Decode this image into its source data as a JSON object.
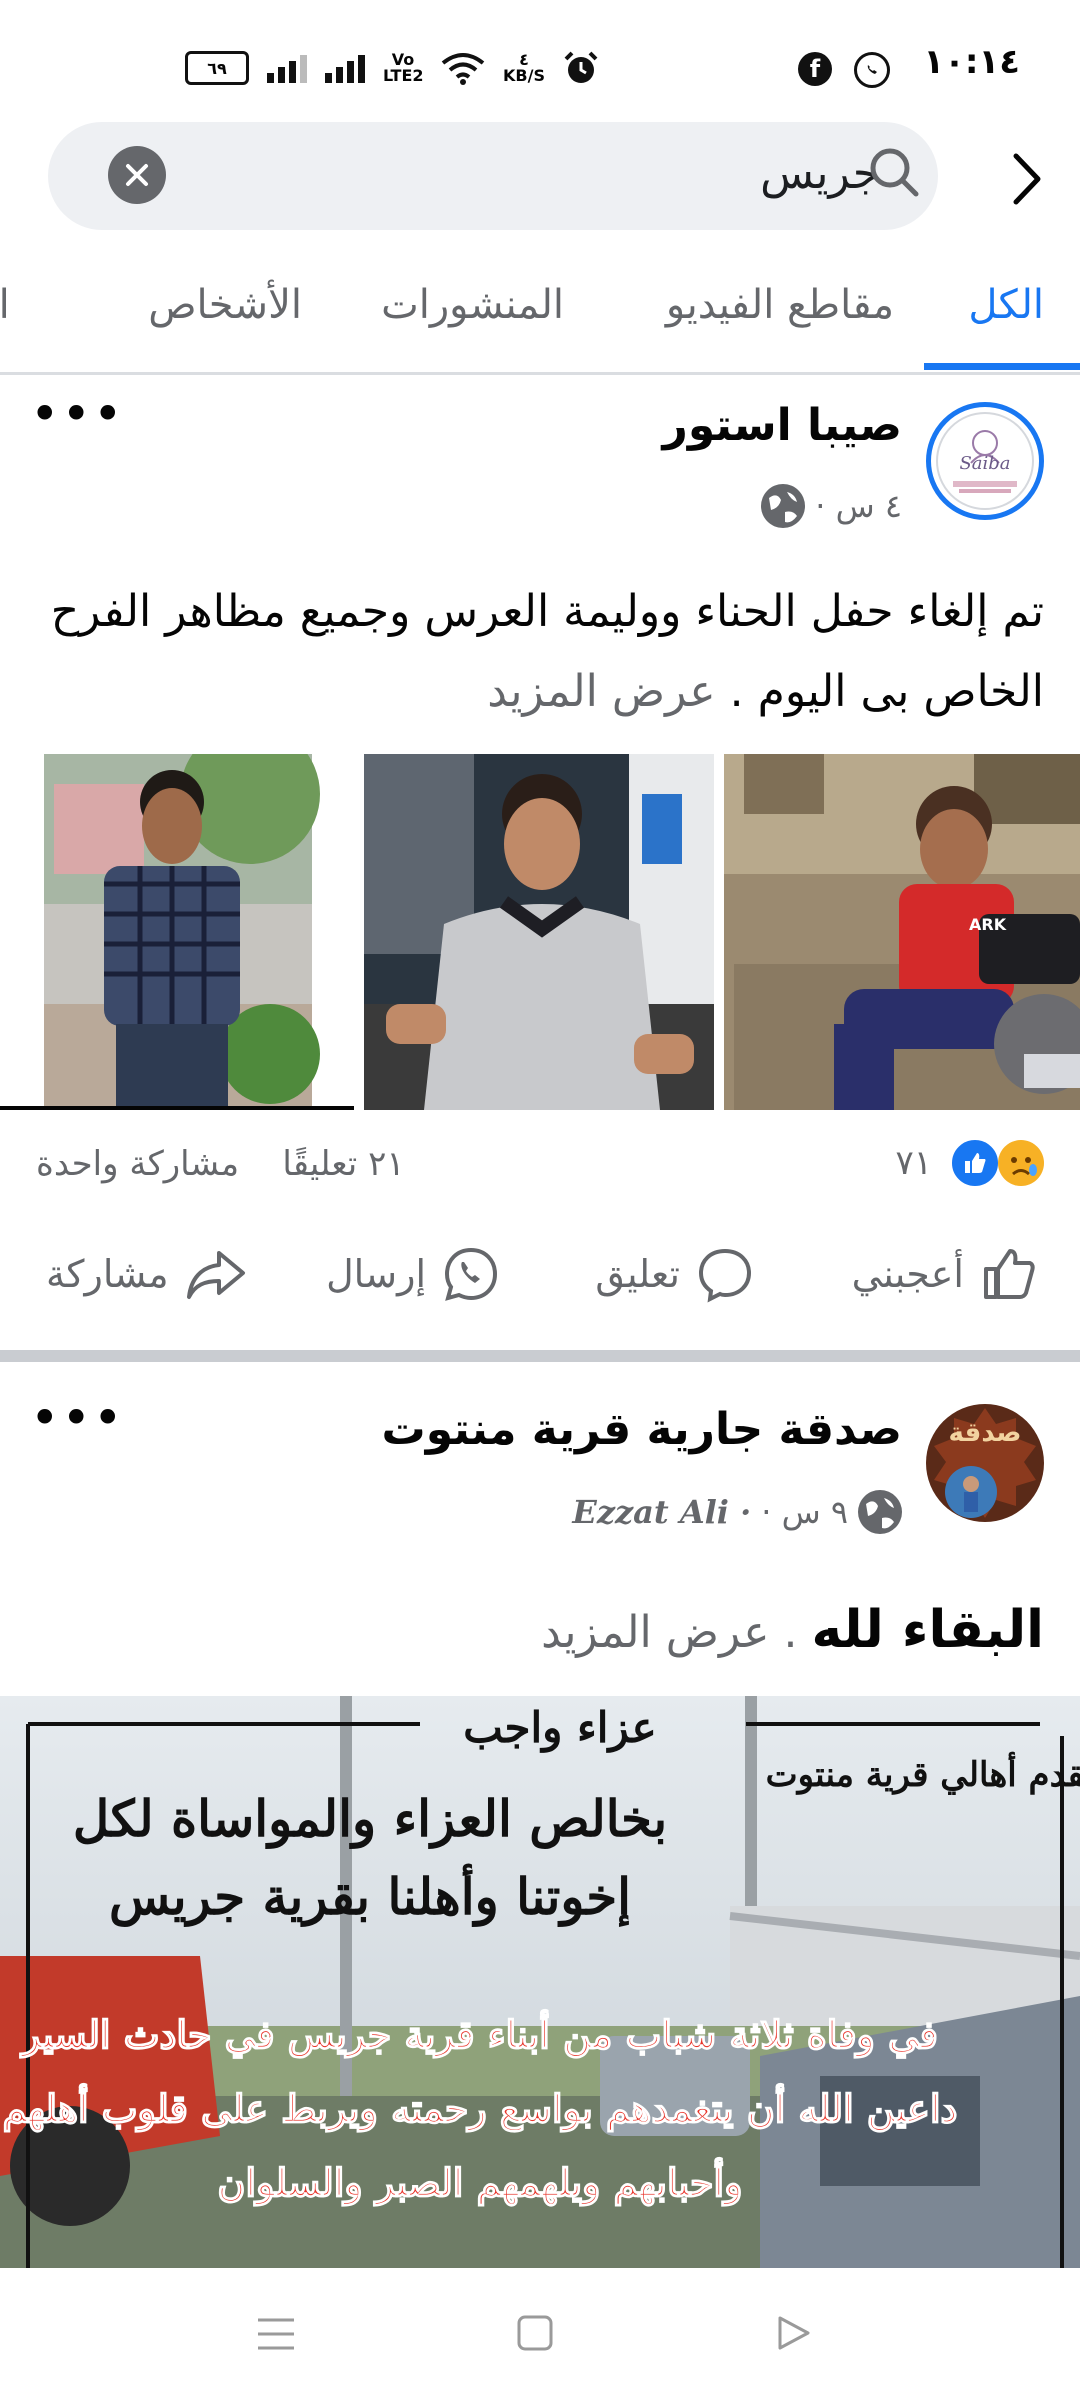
{
  "status_bar": {
    "time": "١٠:١٤",
    "battery": "٦٩",
    "network_speed_value": "٤",
    "network_speed_unit": "KB/S",
    "volte": "Vo LTE2"
  },
  "search": {
    "query": "جريس"
  },
  "tabs": [
    {
      "label": "الكل",
      "active": true
    },
    {
      "label": "مقاطع الفيديو",
      "active": false
    },
    {
      "label": "المنشورات",
      "active": false
    },
    {
      "label": "الأشخاص",
      "active": false
    },
    {
      "label": "المجموعات",
      "active": false
    }
  ],
  "post1": {
    "author": "صيبا استور",
    "avatar_text": "Saiba",
    "time": "٤ س ·",
    "text": "تم إلغاء حفل الحناء ووليمة العرس وجميع مظاهر الفرح الخاص بى اليوم .",
    "see_more": "عرض المزيد",
    "reactions_count": "٧١",
    "comments": "٢١ تعليقًا",
    "shares": "مشاركة واحدة",
    "photo_badge": "ARK"
  },
  "actions": {
    "like": "أعجبني",
    "comment": "تعليق",
    "send": "إرسال",
    "share": "مشاركة"
  },
  "post2": {
    "author": "صدقة جارية قرية منتوت",
    "avatar_text": "صدقة",
    "time": "٩ س ·",
    "poster": "Ezzat Ali ·",
    "text": "البقاء لله",
    "see_more": "عرض المزيد",
    "image": {
      "header_center": "عزاء واجب",
      "header_right": "يتقدم أهالي قرية منتوت",
      "line1": "بخالص العزاء والمواساة لكل",
      "line2": "إخوتنا وأهلنا بقرية جريس",
      "red_line1": "في وفاة ثلاثة شباب من أبناء قرية جريس في حادث السير",
      "red_line2": "داعين الله أن يتغمدهم بواسع رحمته ويربط على قلوب أهلهم",
      "red_line3": "وأحبابهم ويلهمهم الصبر والسلوان"
    }
  },
  "colors": {
    "accent": "#1877f2",
    "secondary_text": "#65676b"
  }
}
